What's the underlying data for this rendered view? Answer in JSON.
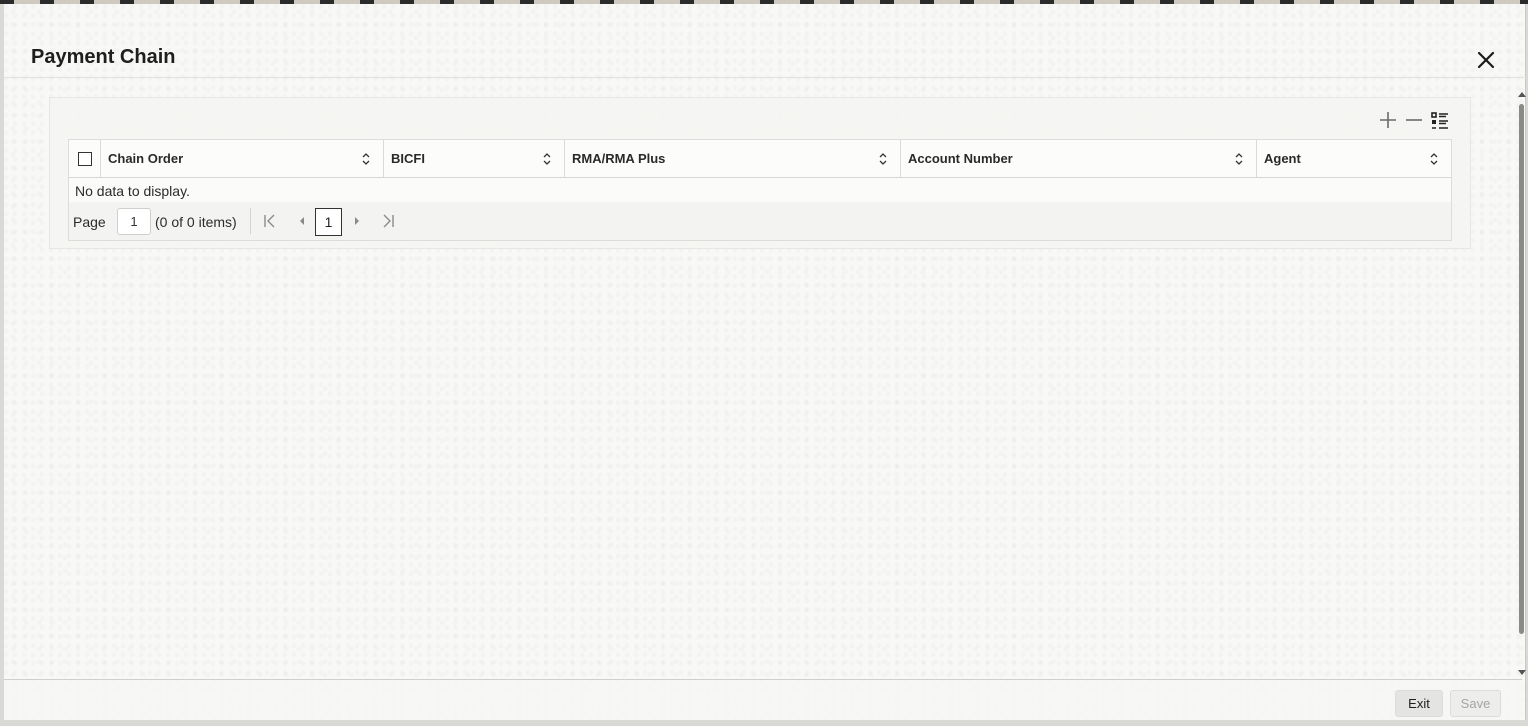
{
  "dialog": {
    "title": "Payment Chain"
  },
  "toolbar": {
    "add_icon": "plus-icon",
    "remove_icon": "minus-icon",
    "columns_icon": "list-icon"
  },
  "table": {
    "columns": [
      {
        "label": "Chain Order"
      },
      {
        "label": "BICFI"
      },
      {
        "label": "RMA/RMA Plus"
      },
      {
        "label": "Account Number"
      },
      {
        "label": "Agent"
      }
    ],
    "rows": [],
    "empty_message": "No data to display."
  },
  "pagination": {
    "page_label": "Page",
    "page_input": "1",
    "count_text": "(0 of 0 items)",
    "current_page": "1"
  },
  "footer": {
    "exit_label": "Exit",
    "save_label": "Save"
  }
}
